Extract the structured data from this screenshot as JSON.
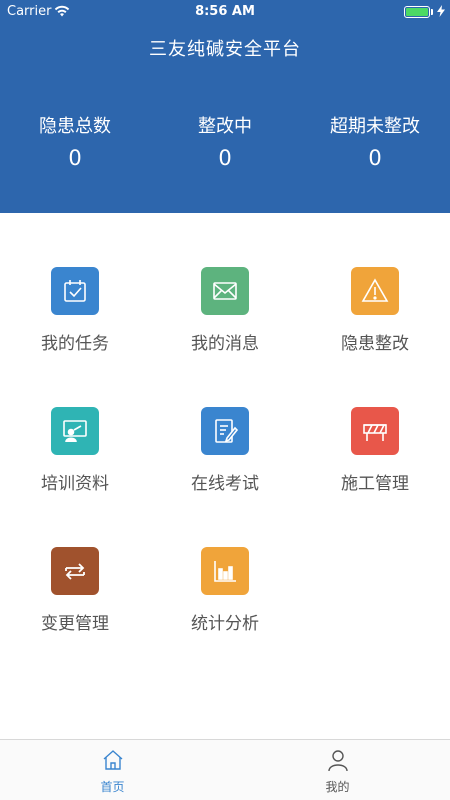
{
  "status_bar": {
    "carrier": "Carrier",
    "time": "8:56 AM",
    "wifi_icon": "wifi-icon",
    "battery_icon": "battery-icon"
  },
  "header": {
    "title": "三友纯碱安全平台",
    "background_color": "#2d66ad",
    "stats": [
      {
        "label": "隐患总数",
        "value": "0"
      },
      {
        "label": "整改中",
        "value": "0"
      },
      {
        "label": "超期未整改",
        "value": "0"
      }
    ]
  },
  "menu": {
    "items": [
      {
        "label": "我的任务",
        "icon": "calendar-check-icon",
        "color": "#3a85cf"
      },
      {
        "label": "我的消息",
        "icon": "mail-icon",
        "color": "#5db37e"
      },
      {
        "label": "隐患整改",
        "icon": "warning-icon",
        "color": "#f0a43a"
      },
      {
        "label": "培训资料",
        "icon": "training-board-icon",
        "color": "#2fb4b4"
      },
      {
        "label": "在线考试",
        "icon": "exam-edit-icon",
        "color": "#3a85cf"
      },
      {
        "label": "施工管理",
        "icon": "barrier-icon",
        "color": "#e8574a"
      },
      {
        "label": "变更管理",
        "icon": "swap-arrows-icon",
        "color": "#a0522d"
      },
      {
        "label": "统计分析",
        "icon": "bar-chart-icon",
        "color": "#f0a43a"
      }
    ]
  },
  "tabbar": {
    "tabs": [
      {
        "label": "首页",
        "icon": "home-icon",
        "active": true,
        "color": "#3a85cf"
      },
      {
        "label": "我的",
        "icon": "user-icon",
        "active": false,
        "color": "#555555"
      }
    ]
  }
}
